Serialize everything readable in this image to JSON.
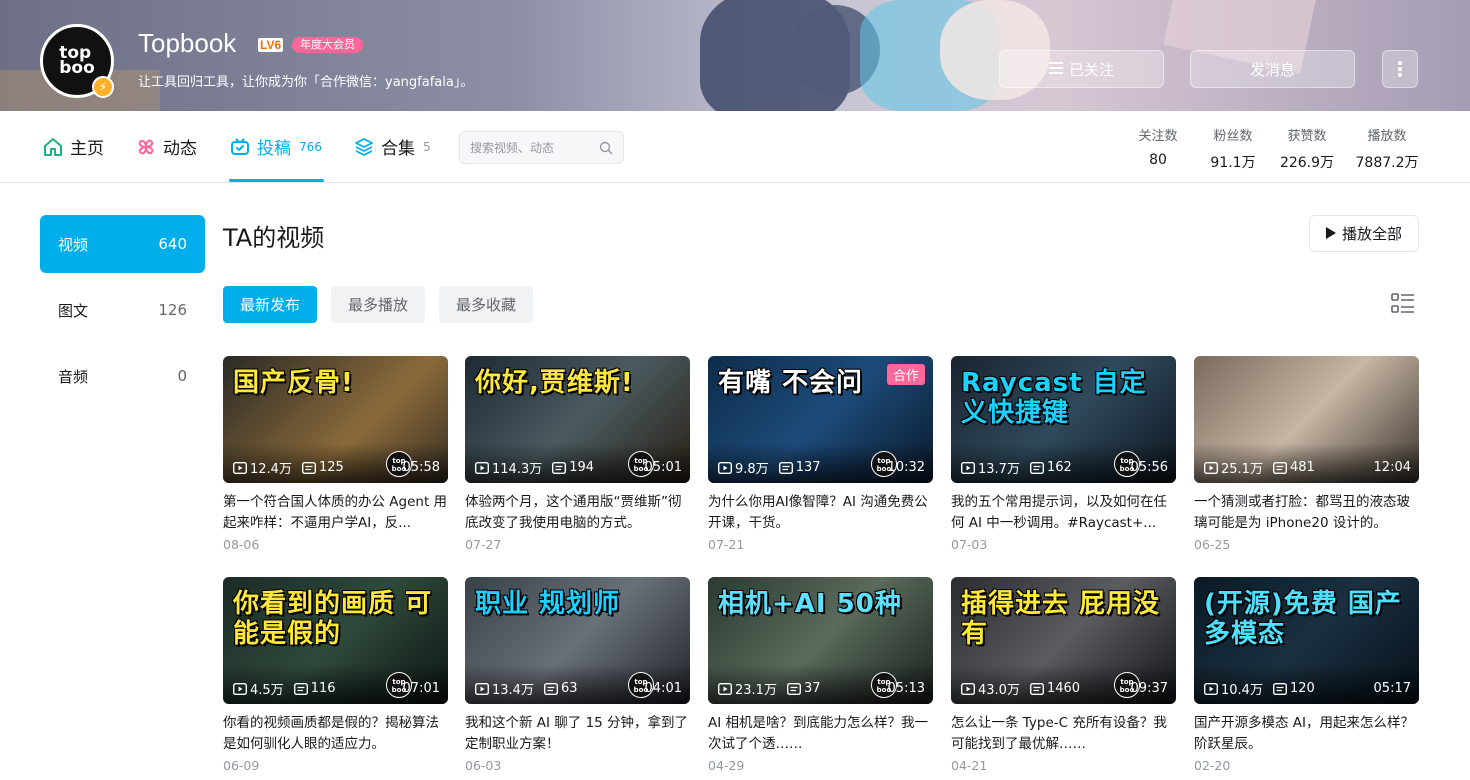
{
  "profile": {
    "avatar_text": "top\nboo",
    "name": "Topbook",
    "level": "LV6",
    "vip_badge": "年度大会员",
    "sign": "让工具回归工具，让你成为你「合作微信：yangfafala」。",
    "follow_label": "已关注",
    "message_label": "发消息"
  },
  "nav": {
    "tabs": [
      {
        "label": "主页",
        "count": ""
      },
      {
        "label": "动态",
        "count": ""
      },
      {
        "label": "投稿",
        "count": "766"
      },
      {
        "label": "合集",
        "count": "5"
      }
    ],
    "search_placeholder": "搜索视频、动态",
    "stats": [
      {
        "label": "关注数",
        "value": "80"
      },
      {
        "label": "粉丝数",
        "value": "91.1万"
      },
      {
        "label": "获赞数",
        "value": "226.9万"
      },
      {
        "label": "播放数",
        "value": "7887.2万"
      }
    ]
  },
  "sidebar": {
    "items": [
      {
        "label": "视频",
        "count": "640"
      },
      {
        "label": "图文",
        "count": "126"
      },
      {
        "label": "音频",
        "count": "0"
      }
    ]
  },
  "main": {
    "title": "TA的视频",
    "play_all": "播放全部",
    "sorts": [
      "最新发布",
      "最多播放",
      "最多收藏"
    ]
  },
  "videos": [
    {
      "headline": "国产反骨!",
      "views": "12.4万",
      "danmaku": "125",
      "duration": "05:58",
      "title": "第一个符合国人体质的办公 Agent 用起来咋样：不逼用户学AI，反...",
      "date": "08-06",
      "tag": ""
    },
    {
      "headline": "你好,贾维斯!",
      "views": "114.3万",
      "danmaku": "194",
      "duration": "05:01",
      "title": "体验两个月，这个通用版“贾维斯”彻底改变了我使用电脑的方式。",
      "date": "07-27",
      "tag": ""
    },
    {
      "headline": "有嘴 不会问",
      "views": "9.8万",
      "danmaku": "137",
      "duration": "10:32",
      "title": "为什么你用AI像智障？AI 沟通免费公开课，干货。",
      "date": "07-21",
      "tag": "合作"
    },
    {
      "headline": "Raycast 自定义快捷键",
      "views": "13.7万",
      "danmaku": "162",
      "duration": "05:56",
      "title": "我的五个常用提示词，以及如何在任何 AI 中一秒调用。#Raycast+...",
      "date": "07-03",
      "tag": ""
    },
    {
      "headline": "",
      "views": "25.1万",
      "danmaku": "481",
      "duration": "12:04",
      "title": "一个猜测或者打脸：都骂丑的液态玻璃可能是为 iPhone20 设计的。",
      "date": "06-25",
      "tag": ""
    },
    {
      "headline": "你看到的画质 可能是假的",
      "views": "4.5万",
      "danmaku": "116",
      "duration": "07:01",
      "title": "你看的视频画质都是假的？揭秘算法是如何驯化人眼的适应力。",
      "date": "06-09",
      "tag": ""
    },
    {
      "headline": "职业 规划师",
      "views": "13.4万",
      "danmaku": "63",
      "duration": "04:01",
      "title": "我和这个新 AI 聊了 15 分钟，拿到了定制职业方案！",
      "date": "06-03",
      "tag": ""
    },
    {
      "headline": "相机+AI 50种",
      "views": "23.1万",
      "danmaku": "37",
      "duration": "05:13",
      "title": "AI 相机是啥？到底能力怎么样？我一次试了个透……",
      "date": "04-29",
      "tag": ""
    },
    {
      "headline": "插得进去 屁用没有",
      "views": "43.0万",
      "danmaku": "1460",
      "duration": "09:37",
      "title": "怎么让一条 Type-C 充所有设备？我可能找到了最优解……",
      "date": "04-21",
      "tag": ""
    },
    {
      "headline": "(开源)免费 国产多模态",
      "views": "10.4万",
      "danmaku": "120",
      "duration": "05:17",
      "title": "国产开源多模态 AI，用起来怎么样？阶跃星辰。",
      "date": "02-20",
      "tag": ""
    }
  ],
  "colors": {
    "accent": "#00aeec",
    "vip": "#ff6699",
    "text": "#18191c",
    "muted": "#9499a0"
  }
}
